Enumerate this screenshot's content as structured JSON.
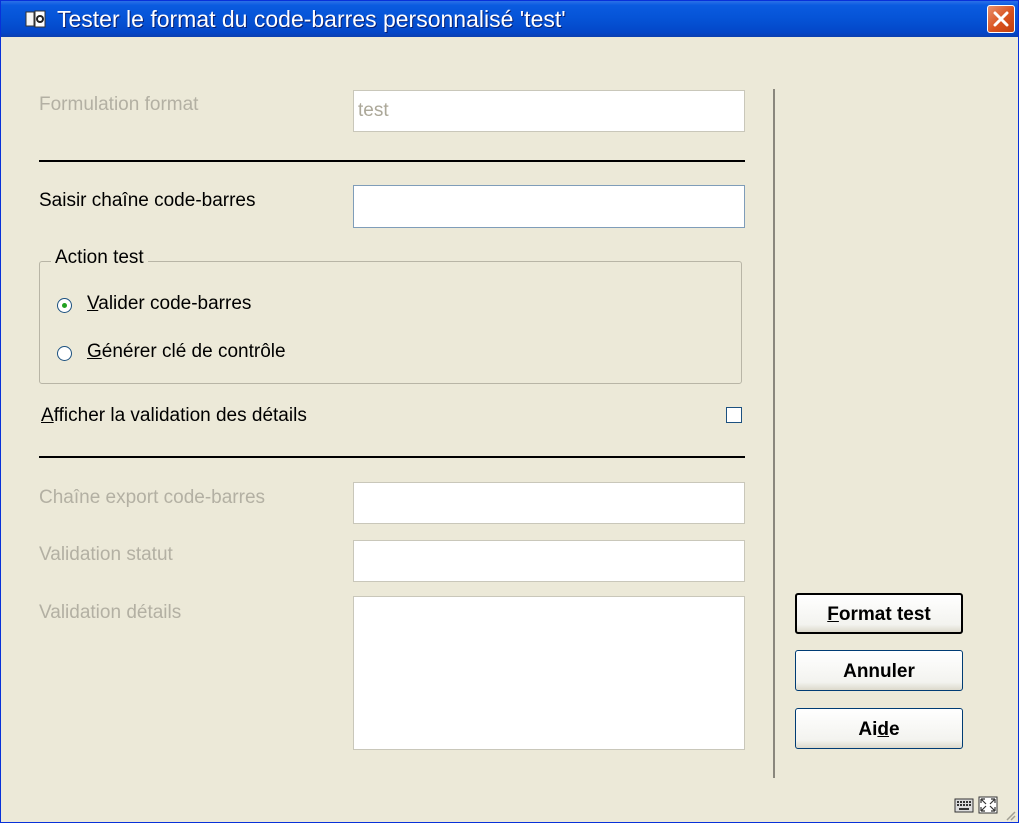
{
  "window": {
    "title": "Tester le format du code-barres personnalisé 'test'",
    "close_label": "✕"
  },
  "form": {
    "format_formula": {
      "label": "Formulation format",
      "value": "test"
    },
    "barcode_input": {
      "label": "Saisir chaîne code-barres",
      "value": ""
    },
    "test_action": {
      "group_label": "Action test",
      "options": [
        {
          "mnemonic": "V",
          "rest": "alider code-barres",
          "selected": true
        },
        {
          "mnemonic": "G",
          "rest": "énérer clé de contrôle",
          "selected": false
        }
      ]
    },
    "show_details": {
      "mnemonic": "A",
      "rest": "fficher la validation des détails",
      "checked": false
    },
    "export_string": {
      "label": "Chaîne export code-barres",
      "value": ""
    },
    "validation_status": {
      "label": "Validation statut",
      "value": ""
    },
    "validation_details": {
      "label": "Validation détails",
      "value": ""
    }
  },
  "buttons": {
    "format_test": {
      "mnemonic": "F",
      "rest": "ormat test"
    },
    "cancel": {
      "label": "Annuler"
    },
    "help": {
      "pre": "Ai",
      "mnemonic": "d",
      "post": "e"
    }
  },
  "colors": {
    "titlebar": "#0553d6",
    "dialog_background": "#ece9d8",
    "close_button": "#d9521e",
    "disabled_text": "#b3b0a3"
  },
  "icons": {
    "app": "library-app-icon",
    "close": "close-icon",
    "keyboard": "keyboard-icon",
    "maximize": "maximize-icon"
  }
}
